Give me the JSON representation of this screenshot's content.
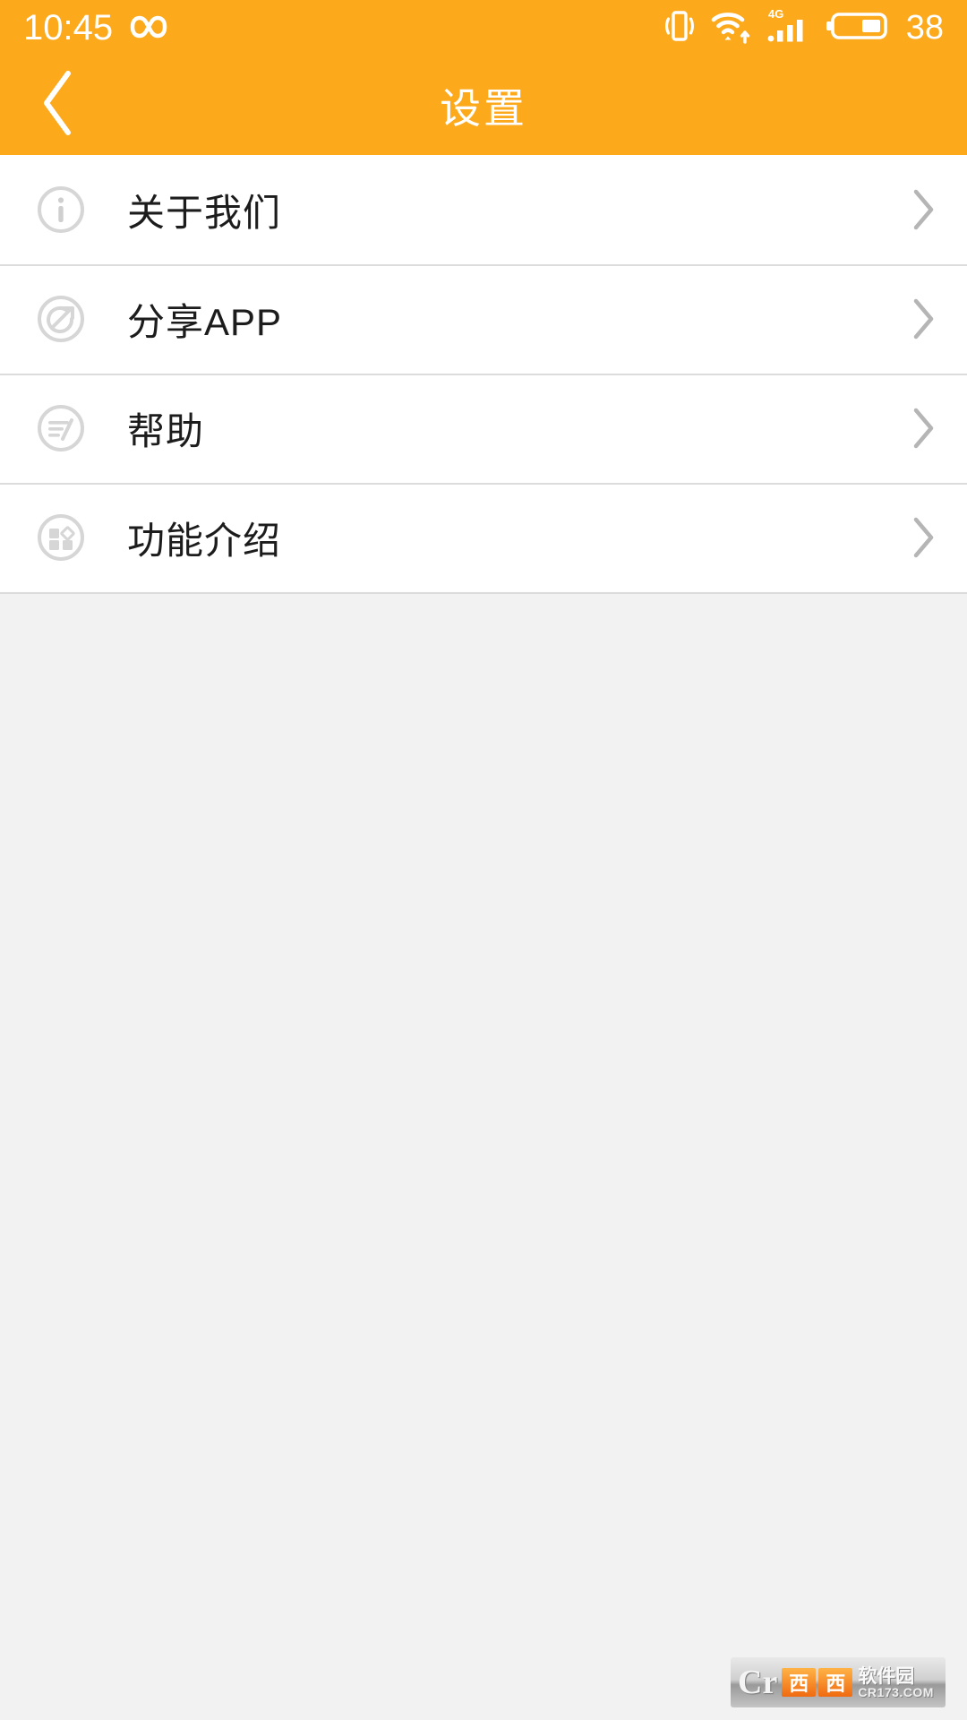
{
  "theme": {
    "accent": "#fca91c",
    "list_bg": "#ffffff",
    "page_bg": "#f2f2f2",
    "divider": "#dcdcdc",
    "text_primary": "#1c1c1c",
    "icon_gray": "#d2d2d2",
    "chevron_gray": "#b5b5b5"
  },
  "status_bar": {
    "time": "10:45",
    "infinity_icon": "infinity-icon",
    "vibrate_icon": "vibrate-icon",
    "wifi_icon": "wifi-icon",
    "network_label": "4G",
    "signal_icon": "signal-bars-icon",
    "battery_icon": "battery-icon",
    "battery_level": "38"
  },
  "header": {
    "back_icon": "back-chevron-icon",
    "title": "设置"
  },
  "list": {
    "items": [
      {
        "icon": "info-circle-icon",
        "label": "关于我们",
        "chevron": "chevron-right-icon"
      },
      {
        "icon": "share-circle-icon",
        "label": "分享APP",
        "chevron": "chevron-right-icon"
      },
      {
        "icon": "help-lines-icon",
        "label": "帮助",
        "chevron": "chevron-right-icon"
      },
      {
        "icon": "grid-blocks-icon",
        "label": "功能介绍",
        "chevron": "chevron-right-icon"
      }
    ]
  },
  "watermark": {
    "mark": "Cr",
    "box1": "西",
    "box2": "西",
    "cn_name": "软件园",
    "url": "CR173.COM"
  }
}
